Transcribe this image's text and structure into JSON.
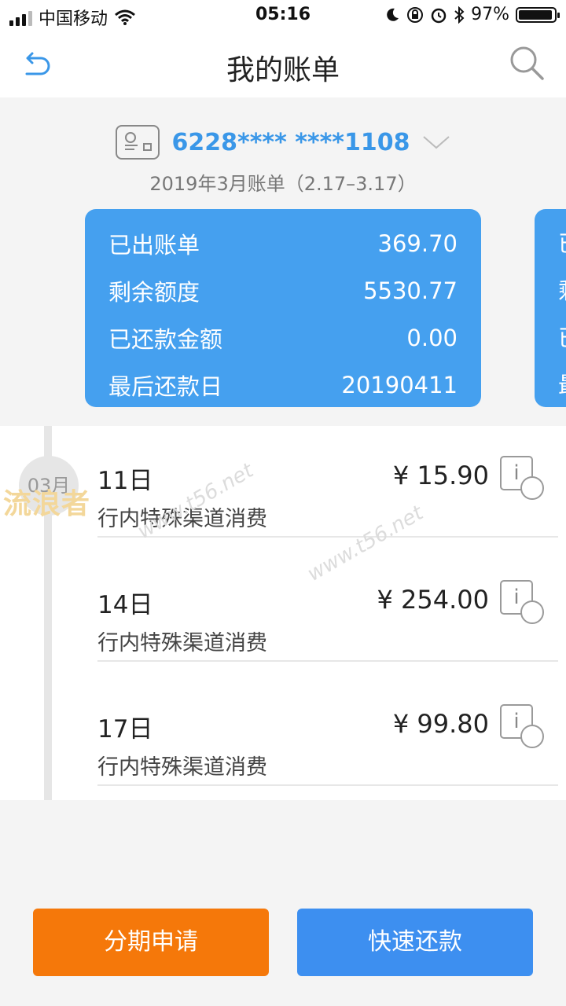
{
  "status_bar": {
    "carrier": "中国移动",
    "time": "05:16",
    "battery": "97%",
    "battery_level": 0.97
  },
  "nav": {
    "title": "我的账单",
    "back_icon": "back-arrow-icon",
    "search_icon": "search-icon"
  },
  "card": {
    "number": "6228**** ****1108",
    "period": "2019年3月账单（2.17–3.17）"
  },
  "summary": {
    "rows": [
      {
        "label": "已出账单",
        "value": "369.70"
      },
      {
        "label": "剩余额度",
        "value": "5530.77"
      },
      {
        "label": "已还款金额",
        "value": "0.00"
      },
      {
        "label": "最后还款日",
        "value": "20190411"
      }
    ],
    "peek": [
      "已",
      "剩",
      "已",
      "最"
    ]
  },
  "month_badge": "03月",
  "transactions": [
    {
      "date": "11日",
      "amount": "¥ 15.90",
      "desc": "行内特殊渠道消费"
    },
    {
      "date": "14日",
      "amount": "¥ 254.00",
      "desc": "行内特殊渠道消费"
    },
    {
      "date": "17日",
      "amount": "¥ 99.80",
      "desc": "行内特殊渠道消费"
    }
  ],
  "watermark": {
    "logo": "流浪者",
    "url": "www.t56.net"
  },
  "buttons": {
    "installment": "分期申请",
    "repay": "快速还款"
  },
  "colors": {
    "summary_bg": "#45a0ef",
    "installment_btn": "#f5780a",
    "repay_btn": "#3d8ff0",
    "card_number": "#3a97e8"
  }
}
